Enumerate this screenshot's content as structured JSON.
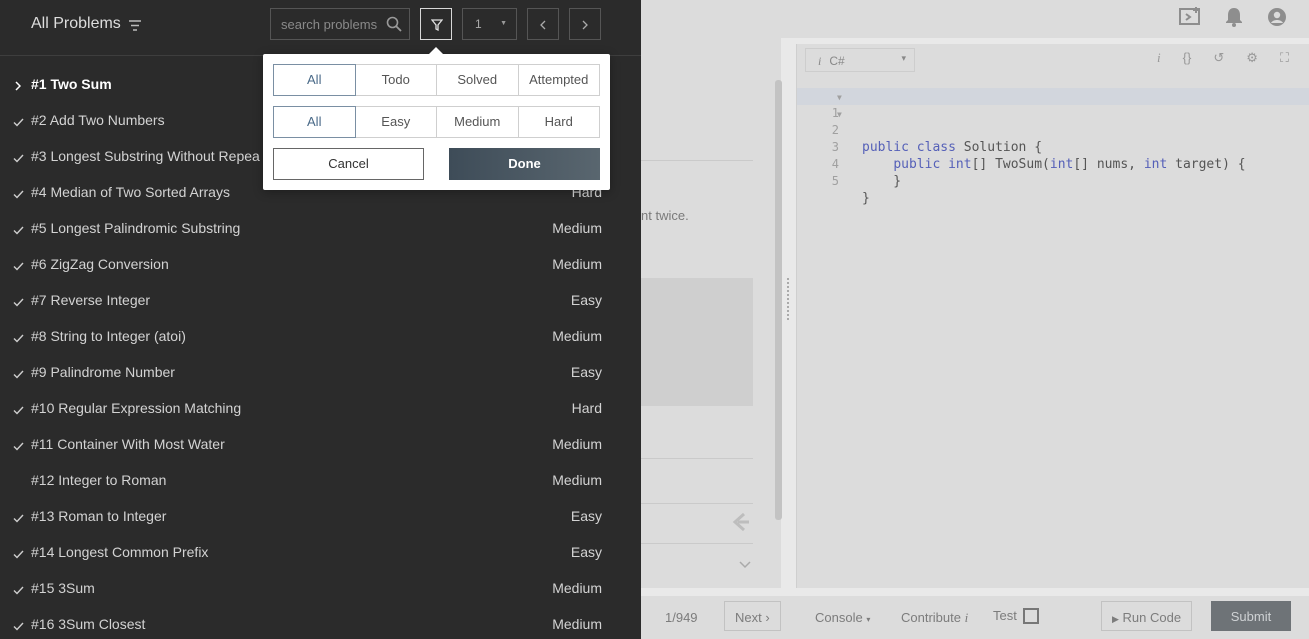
{
  "panel": {
    "title": "All Problems",
    "search": {
      "placeholder": "search problems",
      "value": ""
    },
    "page_select": {
      "value": "1"
    }
  },
  "filter_popover": {
    "status_options": [
      "All",
      "Todo",
      "Solved",
      "Attempted"
    ],
    "status_selected": "All",
    "difficulty_options": [
      "All",
      "Easy",
      "Medium",
      "Hard"
    ],
    "difficulty_selected": "All",
    "cancel_label": "Cancel",
    "done_label": "Done"
  },
  "problems": [
    {
      "name": "#1 Two Sum",
      "difficulty": "",
      "mark": "chevron",
      "active": true
    },
    {
      "name": "#2 Add Two Numbers",
      "difficulty": "",
      "mark": "check"
    },
    {
      "name": "#3 Longest Substring Without Repea",
      "difficulty": "",
      "mark": "check"
    },
    {
      "name": "#4 Median of Two Sorted Arrays",
      "difficulty": "Hard",
      "mark": "check"
    },
    {
      "name": "#5 Longest Palindromic Substring",
      "difficulty": "Medium",
      "mark": "check"
    },
    {
      "name": "#6 ZigZag Conversion",
      "difficulty": "Medium",
      "mark": "check"
    },
    {
      "name": "#7 Reverse Integer",
      "difficulty": "Easy",
      "mark": "check"
    },
    {
      "name": "#8 String to Integer (atoi)",
      "difficulty": "Medium",
      "mark": "check"
    },
    {
      "name": "#9 Palindrome Number",
      "difficulty": "Easy",
      "mark": "check"
    },
    {
      "name": "#10 Regular Expression Matching",
      "difficulty": "Hard",
      "mark": "check"
    },
    {
      "name": "#11 Container With Most Water",
      "difficulty": "Medium",
      "mark": "check"
    },
    {
      "name": "#12 Integer to Roman",
      "difficulty": "Medium",
      "mark": "none"
    },
    {
      "name": "#13 Roman to Integer",
      "difficulty": "Easy",
      "mark": "check"
    },
    {
      "name": "#14 Longest Common Prefix",
      "difficulty": "Easy",
      "mark": "check"
    },
    {
      "name": "#15 3Sum",
      "difficulty": "Medium",
      "mark": "check"
    },
    {
      "name": "#16 3Sum Closest",
      "difficulty": "Medium",
      "mark": "check"
    }
  ],
  "background": {
    "description_fragment": "nt twice.",
    "editor": {
      "language": "C#",
      "language_icon": "i",
      "code_lines": [
        "public class Solution {",
        "    public int[] TwoSum(int[] nums, int target) {",
        "",
        "    }",
        "}"
      ],
      "line_numbers": [
        "1",
        "2",
        "3",
        "4",
        "5"
      ]
    },
    "bottom_bar": {
      "pagination": "1/949",
      "next_label": "Next",
      "console_label": "Console",
      "contribute_label": "Contribute",
      "contribute_icon": "i",
      "test_label": "Test",
      "run_code_label": "Run Code",
      "submit_label": "Submit"
    }
  }
}
